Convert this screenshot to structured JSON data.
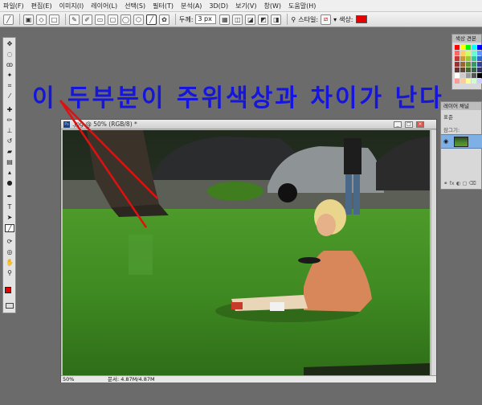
{
  "menu": [
    "파일(F)",
    "편집(E)",
    "이미지(I)",
    "레이어(L)",
    "선택(S)",
    "필터(T)",
    "분석(A)",
    "3D(D)",
    "보기(V)",
    "창(W)",
    "도움말(H)"
  ],
  "options_bar": {
    "width_label": "두께:",
    "width_value": "3 px",
    "style_label": "스타일:",
    "color_label": "색상:",
    "color_value": "#e60000"
  },
  "annotation": "이 두부분이 주위색상과 차이가 난다",
  "document": {
    "title": ".jpg @ 50% (RGB/8) *",
    "zoom": "50%",
    "info": "문서: 4.87M/4.87M"
  },
  "swatch_panel": {
    "tabs": "색상 견본"
  },
  "layers_panel": {
    "tabs": "레이어 채널",
    "blend_mode": "표준",
    "lock": "잠그기:"
  },
  "toolbox": {
    "foreground": "#e80000",
    "background": "#1a1ad0"
  }
}
